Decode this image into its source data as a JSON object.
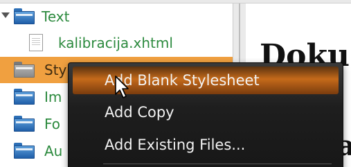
{
  "tree": {
    "items": [
      {
        "label": "Text",
        "icon": "folder-icon",
        "expanded": true
      },
      {
        "label": "kalibracija.xhtml",
        "icon": "document-icon"
      },
      {
        "label": "Sty",
        "icon": "folder-icon",
        "selected": true
      },
      {
        "label": "Im",
        "icon": "folder-icon"
      },
      {
        "label": "Fo",
        "icon": "folder-icon"
      },
      {
        "label": "Au",
        "icon": "folder-icon"
      }
    ]
  },
  "preview": {
    "heading_fragment": "Doku",
    "letter_fragment": "a"
  },
  "context_menu": {
    "items": [
      {
        "label": "Add Blank Stylesheet",
        "highlighted": true
      },
      {
        "label": "Add Copy"
      },
      {
        "label": "Add Existing Files..."
      }
    ]
  },
  "colors": {
    "tree_text": "#2c8a3e",
    "selection": "#f0a040",
    "menu_background": "#1e1e1e",
    "menu_highlight": "#c56a1a",
    "folder_blue": "#2c6fb6"
  }
}
